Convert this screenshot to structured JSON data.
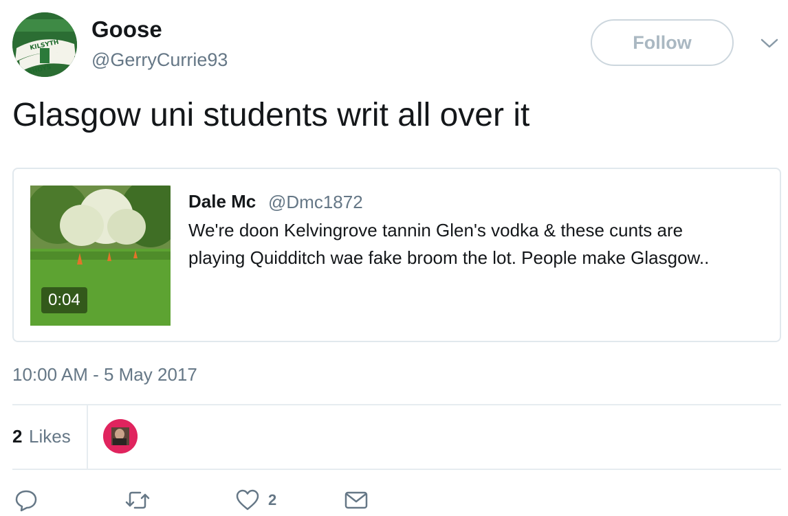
{
  "author": {
    "name": "Goose",
    "handle": "@GerryCurrie93",
    "avatar_banner_text_top": "KILSYTH",
    "avatar_banner_text_bottom": "BHOYS"
  },
  "follow_button": {
    "label": "Follow"
  },
  "menu": {
    "icon": "chevron-down-icon"
  },
  "tweet": {
    "text": "Glasgow uni students writ all over it"
  },
  "quoted_tweet": {
    "name": "Dale Mc",
    "handle": "@Dmc1872",
    "text_line1": "We're doon Kelvingrove tannin Glen's vodka & these cunts are",
    "text_line2": "playing Quidditch wae fake broom the lot.  People make Glasgow..",
    "media": {
      "type": "video",
      "duration": "0:04"
    }
  },
  "timestamp": "10:00 AM - 5 May 2017",
  "stats": {
    "likes_count": "2",
    "likes_label": "Likes"
  },
  "actions": {
    "reply_icon": "reply-icon",
    "retweet_icon": "retweet-icon",
    "like_icon": "heart-icon",
    "like_count": "2",
    "message_icon": "envelope-icon"
  },
  "colors": {
    "text": "#14171a",
    "secondary": "#657786",
    "border": "#e1e8ed",
    "liker_avatar": "#e0245e"
  }
}
